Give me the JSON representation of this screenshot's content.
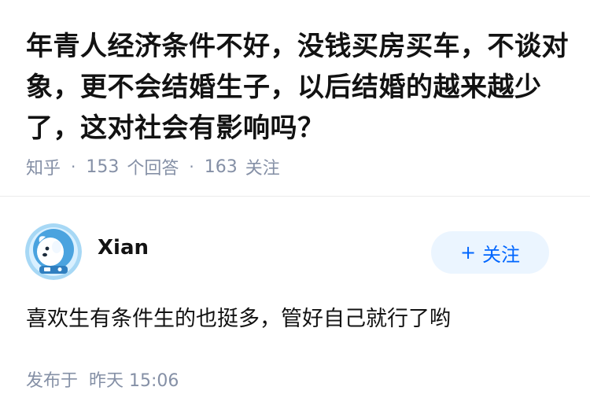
{
  "question": {
    "title": "年青人经济条件不好，没钱买房买车，不谈对象，更不会结婚生子，以后结婚的越来越少了，这对社会有影响吗？",
    "source": "知乎",
    "answer_count": "153",
    "answer_label": "个回答",
    "follower_count": "163",
    "follower_label": "关注"
  },
  "answer": {
    "author": {
      "name": "Xian",
      "avatar_icon": "astronaut-dog-avatar"
    },
    "follow_button": {
      "plus": "+",
      "label": "关注"
    },
    "content": "喜欢生有条件生的也挺多，管好自己就行了哟",
    "time": {
      "prefix": "发布于",
      "value": "昨天 15:06"
    }
  },
  "colors": {
    "accent": "#0066ff",
    "follow_bg": "#ebf5ff",
    "meta_gray": "#8590a6",
    "text": "#121212"
  }
}
